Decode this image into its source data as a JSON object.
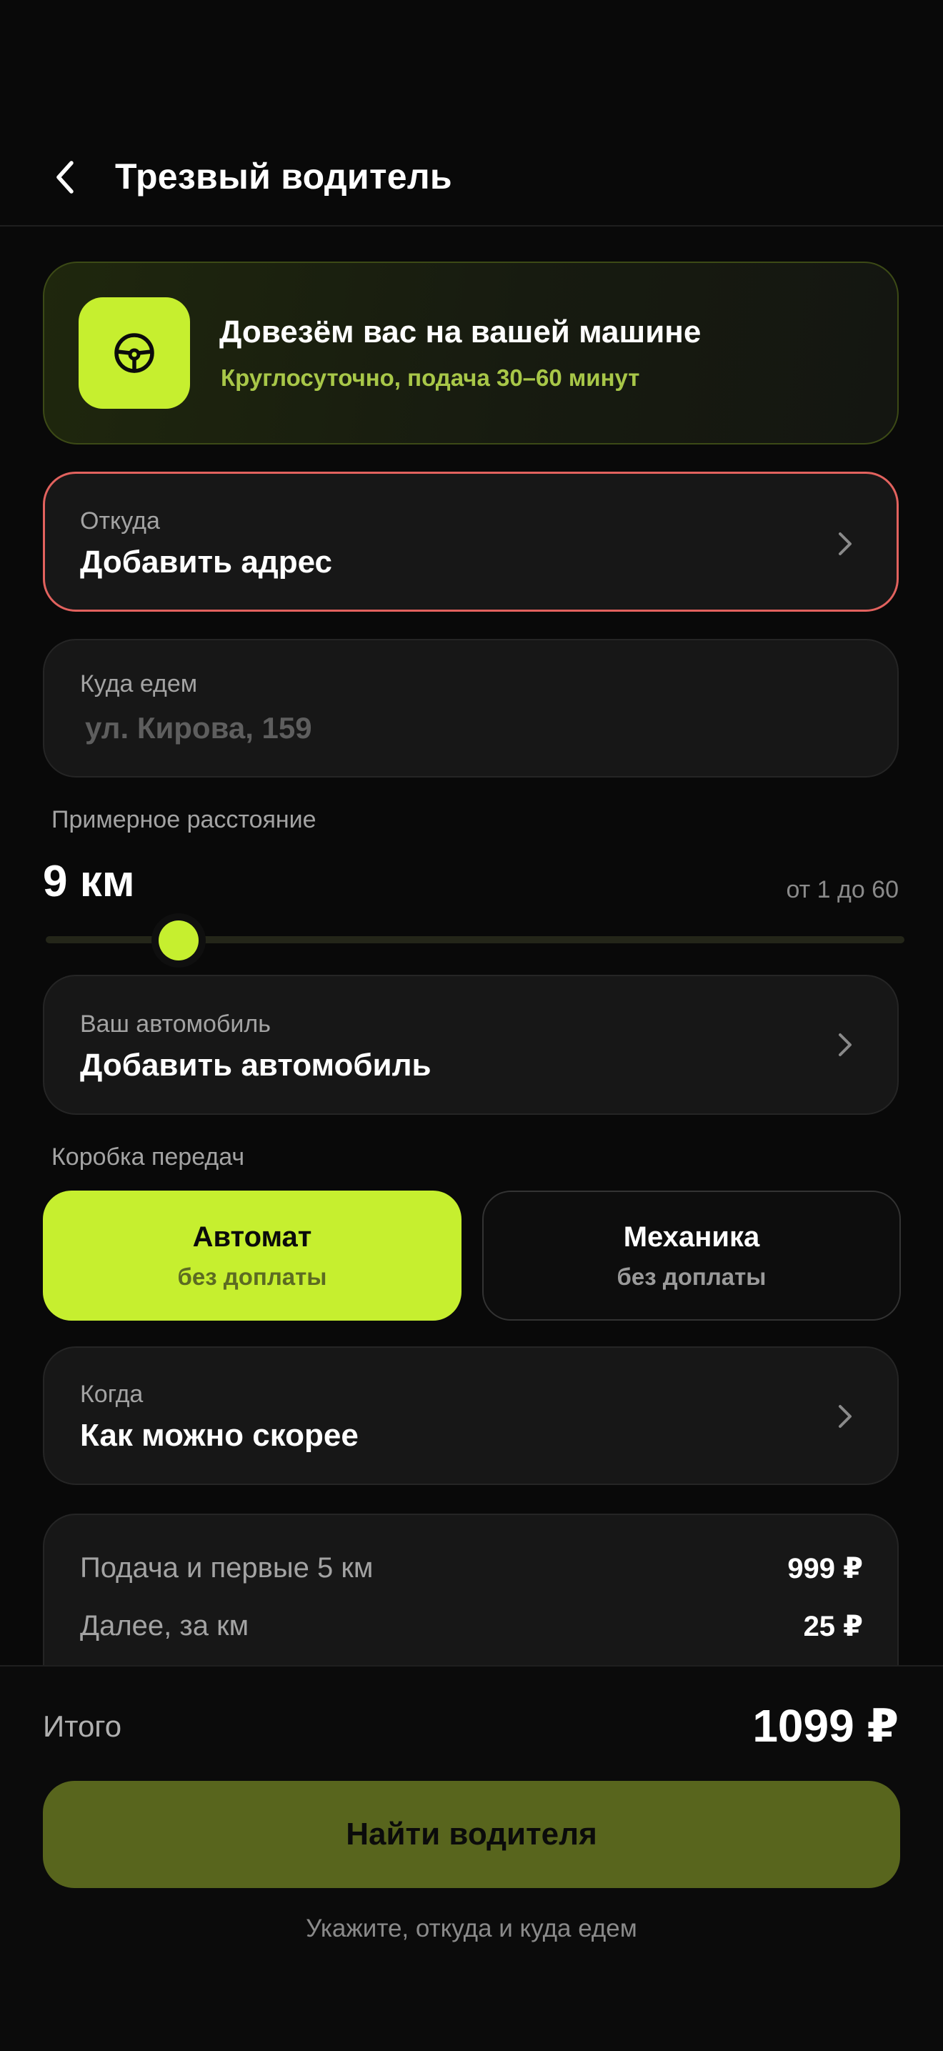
{
  "header": {
    "title": "Трезвый водитель",
    "back_icon": "chevron-left-icon"
  },
  "hero": {
    "icon": "steering-wheel-icon",
    "title": "Довезём вас на вашей машине",
    "subtitle": "Круглосуточно, подача 30–60 минут",
    "accent_color": "#c6ef2f"
  },
  "from": {
    "label": "Откуда",
    "value": "Добавить адрес",
    "border_color": "#e2625e"
  },
  "to": {
    "label": "Куда едем",
    "placeholder": "ул. Кирова, 159"
  },
  "distance": {
    "label": "Примерное расстояние",
    "value_text": "9 км",
    "value": 9,
    "min": 1,
    "max": 60,
    "range_text": "от 1 до 60"
  },
  "car": {
    "label": "Ваш автомобиль",
    "value": "Добавить автомобиль"
  },
  "transmission": {
    "label": "Коробка передач",
    "options": [
      {
        "title": "Автомат",
        "subtitle": "без доплаты",
        "selected": true
      },
      {
        "title": "Механика",
        "subtitle": "без доплаты",
        "selected": false
      }
    ]
  },
  "when": {
    "label": "Когда",
    "value": "Как можно скорее"
  },
  "pricing": {
    "rows": [
      {
        "label": "Подача и первые 5 км",
        "value": "999 ₽"
      },
      {
        "label": "Далее, за км",
        "value": "25 ₽"
      }
    ]
  },
  "footer": {
    "total_label": "Итого",
    "total_value": "1099 ₽",
    "cta_label": "Найти водителя",
    "hint": "Укажите, откуда и куда едем"
  }
}
